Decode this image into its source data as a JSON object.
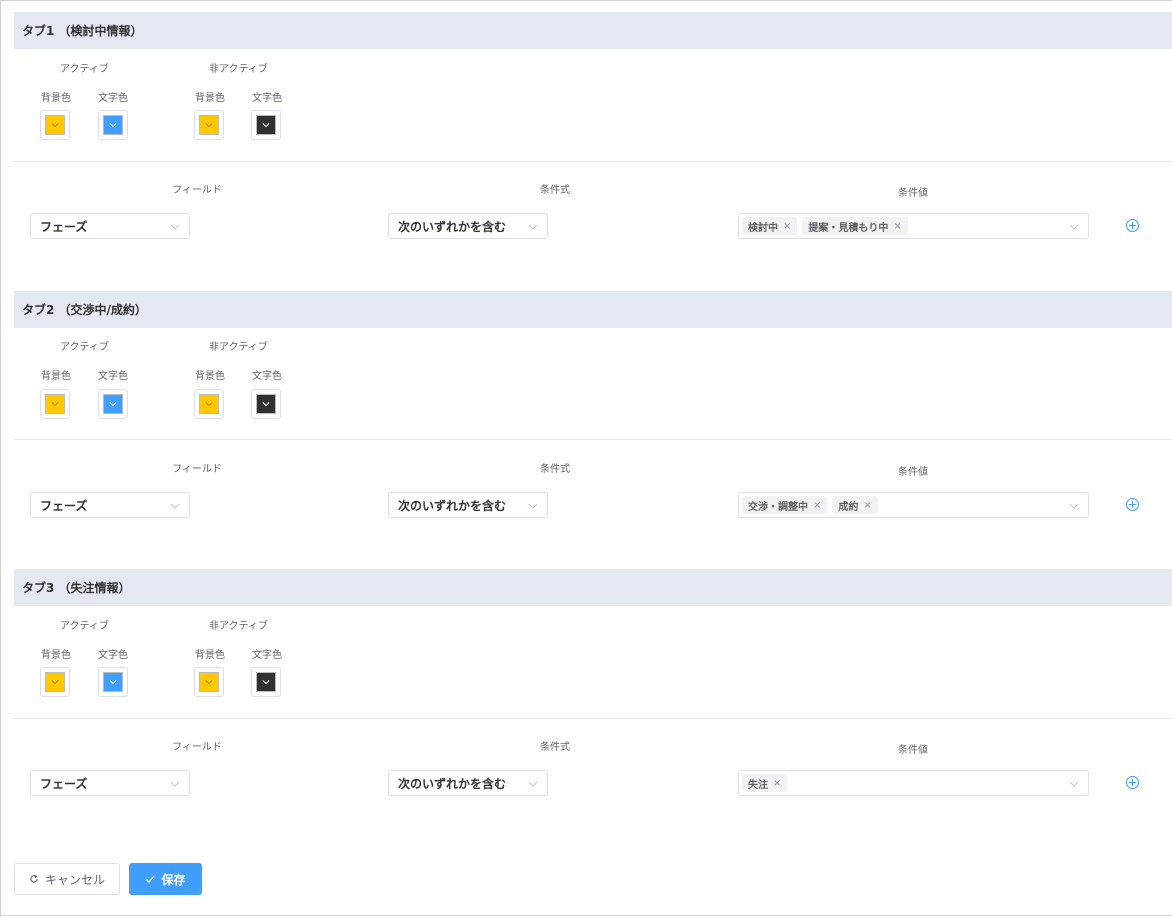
{
  "sections": [
    {
      "header": "タブ1 （検討中情報）",
      "labels": {
        "active": "アクティブ",
        "inactive": "非アクティブ",
        "bg": "背景色",
        "text": "文字色"
      },
      "colors": {
        "active_bg": "#ffc800",
        "active_text": "#409eff",
        "inactive_bg": "#ffc800",
        "inactive_text": "#303030"
      },
      "columns": {
        "field": "フィールド",
        "expression": "条件式",
        "value": "条件値"
      },
      "field_value": "フェーズ",
      "expression_value": "次のいずれかを含む",
      "tags": [
        "検討中",
        "提案・見積もり中"
      ]
    },
    {
      "header": "タブ2 （交渉中/成約）",
      "labels": {
        "active": "アクティブ",
        "inactive": "非アクティブ",
        "bg": "背景色",
        "text": "文字色"
      },
      "colors": {
        "active_bg": "#ffc800",
        "active_text": "#409eff",
        "inactive_bg": "#ffc800",
        "inactive_text": "#303030"
      },
      "columns": {
        "field": "フィールド",
        "expression": "条件式",
        "value": "条件値"
      },
      "field_value": "フェーズ",
      "expression_value": "次のいずれかを含む",
      "tags": [
        "交渉・調整中",
        "成約"
      ]
    },
    {
      "header": "タブ3 （失注情報）",
      "labels": {
        "active": "アクティブ",
        "inactive": "非アクティブ",
        "bg": "背景色",
        "text": "文字色"
      },
      "colors": {
        "active_bg": "#ffc800",
        "active_text": "#409eff",
        "inactive_bg": "#ffc800",
        "inactive_text": "#303030"
      },
      "columns": {
        "field": "フィールド",
        "expression": "条件式",
        "value": "条件値"
      },
      "field_value": "フェーズ",
      "expression_value": "次のいずれかを含む",
      "tags": [
        "失注"
      ]
    }
  ],
  "tag_remove_glyph": "×",
  "icons": {
    "chevron": "chevron-down-icon",
    "add": "plus-circle-icon",
    "cancel": "refresh-icon",
    "save": "check-icon"
  },
  "footer": {
    "cancel_label": "キャンセル",
    "save_label": "保存"
  }
}
